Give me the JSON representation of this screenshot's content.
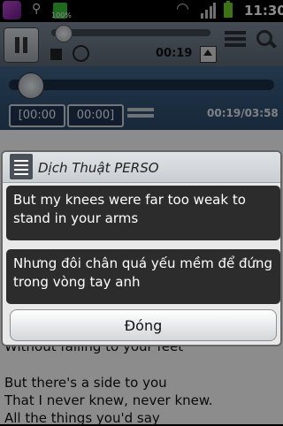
{
  "status_bar": {
    "battery_small_label": "100%",
    "time": "11:30"
  },
  "toolbar": {
    "mini_time": "00:19"
  },
  "player": {
    "point_a": "[00:00",
    "point_b": "00:00]",
    "position": "00:19/03:58"
  },
  "lyrics": {
    "lines": [
      "Without falling to your feet",
      "But there's a side to you",
      "That I never knew, never knew.",
      "All the things you'd say"
    ]
  },
  "dialog": {
    "title": "Dịch Thuật PERSO",
    "original_text": " But my knees were far too weak to stand in your arms",
    "translated_text": "Nhưng đôi chân quá yếu mềm để đứng trong vòng tay anh",
    "close_label": "Đóng"
  },
  "colors": {
    "toolbar": "#6f7c8a",
    "player": "#345679",
    "dialog_box": "#2c2c2c"
  }
}
